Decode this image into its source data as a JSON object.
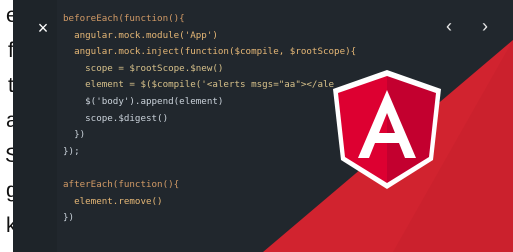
{
  "background_text": {
    "letters": [
      "e",
      "f",
      "t",
      "a",
      "S",
      "g",
      "k"
    ]
  },
  "viewer": {
    "close_icon": "close-icon",
    "prev_icon": "chevron-left-icon",
    "next_icon": "chevron-right-icon",
    "close_glyph": "×",
    "prev_glyph": "‹",
    "next_glyph": "›"
  },
  "code": {
    "line_numbers": [
      "",
      "",
      "",
      "",
      "",
      "",
      "",
      "",
      "",
      "",
      "",
      "",
      "",
      ""
    ],
    "lines": [
      "beforeEach(function(){",
      "  angular.mock.module('App')",
      "  angular.mock.inject(function($compile, $rootScope){",
      "    scope = $rootScope.$new()",
      "    element = $($compile('<alerts msgs=\"aa\"></ale",
      "    $('body').append(element)",
      "    scope.$digest()",
      "  })",
      "});",
      "",
      "afterEach(function(){",
      "  element.remove()",
      "})"
    ]
  },
  "logo": {
    "name": "angular-logo",
    "letter": "A"
  },
  "colors": {
    "viewer_bg": "#21272d",
    "accent_red": "#d1232f",
    "angular_red": "#dd0031",
    "angular_dark_red": "#c3002f"
  }
}
